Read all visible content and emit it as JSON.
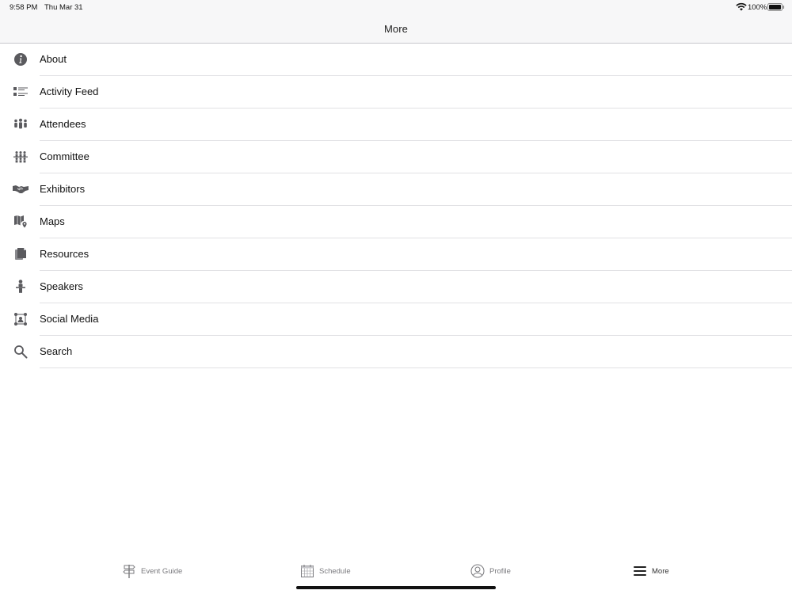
{
  "status_bar": {
    "time": "9:58 PM",
    "date": "Thu Mar 31",
    "battery": "100%"
  },
  "nav": {
    "title": "More"
  },
  "menu": {
    "items": [
      {
        "label": "About",
        "icon": "info-icon"
      },
      {
        "label": "Activity Feed",
        "icon": "list-icon"
      },
      {
        "label": "Attendees",
        "icon": "people-icon"
      },
      {
        "label": "Committee",
        "icon": "group-icon"
      },
      {
        "label": "Exhibitors",
        "icon": "handshake-icon"
      },
      {
        "label": "Maps",
        "icon": "map-icon"
      },
      {
        "label": "Resources",
        "icon": "documents-icon"
      },
      {
        "label": "Speakers",
        "icon": "speaker-icon"
      },
      {
        "label": "Social Media",
        "icon": "network-icon"
      },
      {
        "label": "Search",
        "icon": "search-icon"
      }
    ]
  },
  "tabs": [
    {
      "label": "Event Guide",
      "icon": "signpost-icon"
    },
    {
      "label": "Schedule",
      "icon": "calendar-icon"
    },
    {
      "label": "Profile",
      "icon": "profile-icon"
    },
    {
      "label": "More",
      "icon": "menu-icon",
      "active": true
    }
  ],
  "colors": {
    "icon": "#5a5a5e",
    "separator": "#e1e1e4",
    "bar_background": "#f7f7f8"
  }
}
